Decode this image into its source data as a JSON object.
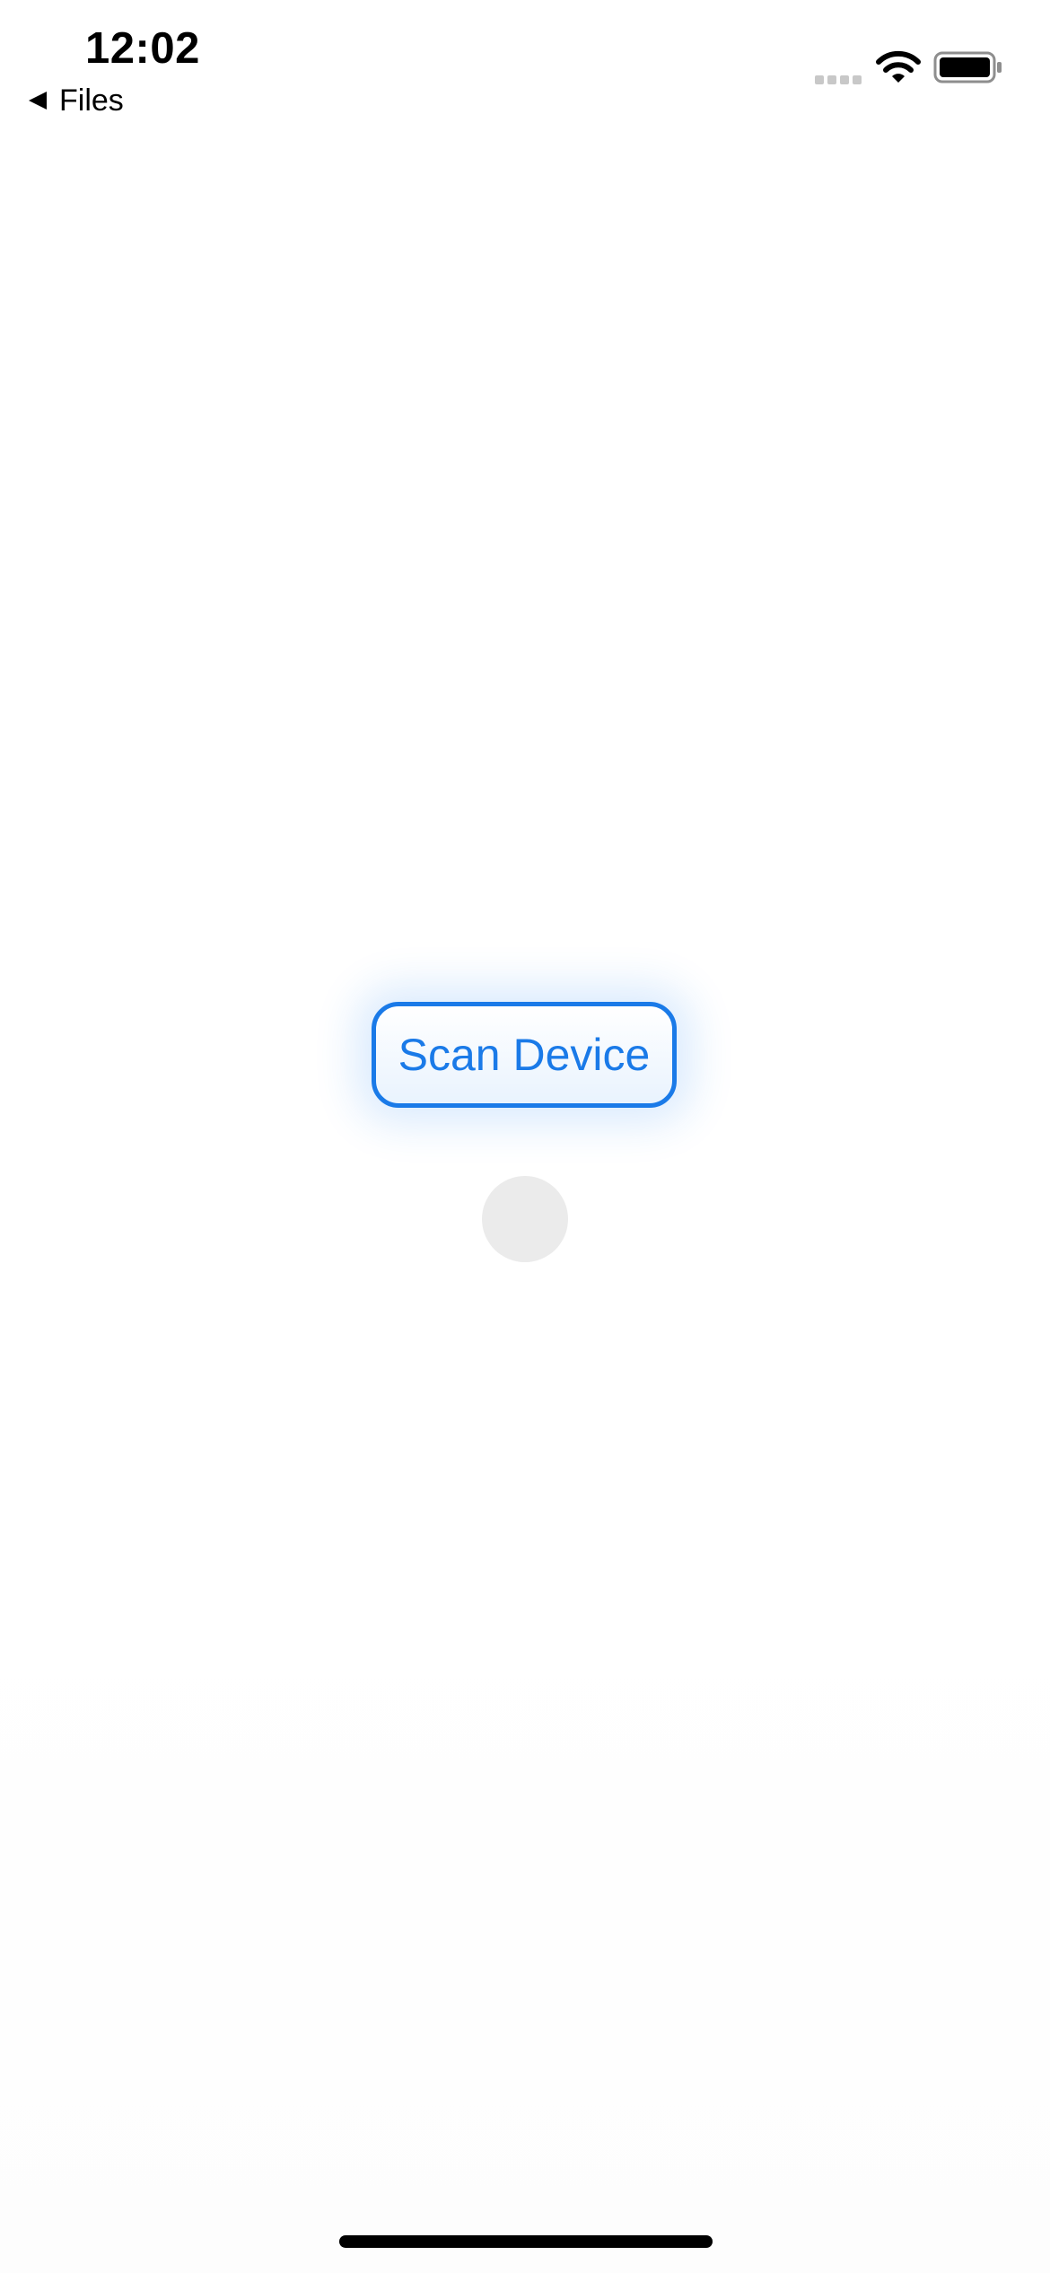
{
  "status_bar": {
    "time": "12:02",
    "signal_icon": "cellular-signal-icon",
    "wifi_icon": "wifi-icon",
    "battery_icon": "battery-icon"
  },
  "navigation": {
    "back_label": "Files",
    "back_icon": "back-triangle-icon"
  },
  "main": {
    "scan_button_label": "Scan Device",
    "accent_color": "#1a7ae8",
    "activity_indicator": "loading-indicator"
  }
}
